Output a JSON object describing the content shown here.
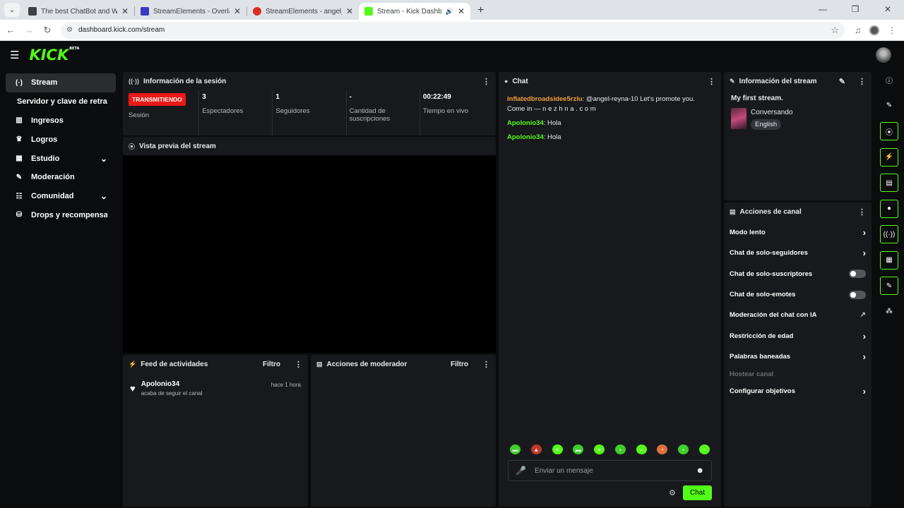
{
  "browser": {
    "tabs": [
      {
        "title": "The best ChatBot and Widgets",
        "fav_color": "#3c4043",
        "active": false
      },
      {
        "title": "StreamElements - Overlays",
        "fav_color": "#3a3bbf",
        "active": false
      },
      {
        "title": "StreamElements - angel_reyna_",
        "fav_color": "#d93025",
        "active": false
      },
      {
        "title": "Stream - Kick Dashboard",
        "fav_color": "#53fc18",
        "active": true
      }
    ],
    "url": "dashboard.kick.com/stream"
  },
  "app": {
    "logo": "KICK",
    "logo_badge": "BETA"
  },
  "sidebar": {
    "items": [
      {
        "label": "Stream",
        "icon": "(·)"
      },
      {
        "label": "Servidor y clave de retransmisión",
        "icon": ""
      },
      {
        "label": "Ingresos",
        "icon": "▥"
      },
      {
        "label": "Logros",
        "icon": "🏆"
      },
      {
        "label": "Estudio",
        "icon": "▦"
      },
      {
        "label": "Moderación",
        "icon": "🔧"
      },
      {
        "label": "Comunidad",
        "icon": "☷"
      },
      {
        "label": "Drops y recompensas",
        "icon": "⛁"
      }
    ]
  },
  "session": {
    "title": "Información de la sesión",
    "live_badge": "TRANSMITIENDO",
    "stats": [
      {
        "value": "",
        "label": "Sesión"
      },
      {
        "value": "3",
        "label": "Espectadores"
      },
      {
        "value": "1",
        "label": "Seguidores"
      },
      {
        "value": "-",
        "label": "Cantidad de suscripciones"
      },
      {
        "value": "00:22:49",
        "label": "Tiempo en vivo"
      }
    ]
  },
  "preview": {
    "title": "Vista previa del stream"
  },
  "feed": {
    "title": "Feed de actividades",
    "filter": "Filtro",
    "item": {
      "name": "Apolonio34",
      "desc": "acaba de seguir el canal",
      "time": "hace 1 hora"
    }
  },
  "modactions": {
    "title": "Acciones de moderador",
    "filter": "Filtro"
  },
  "chat": {
    "title": "Chat",
    "messages": [
      {
        "user": "inflatedbroadsidee5rzlu",
        "text": ": @angel-reyna-10 Let's promote you. Come in — n e z h n a . c o m"
      },
      {
        "user": "Apolonio34",
        "text": ": Hola"
      },
      {
        "user": "Apolonio34",
        "text": ": Hola"
      }
    ],
    "placeholder": "Enviar un mensaje",
    "send": "Chat"
  },
  "stream_info": {
    "title": "Información del stream",
    "stream_title": "My first stream.",
    "category": "Conversando",
    "language": "English"
  },
  "channel_actions": {
    "title": "Acciones de canal",
    "items": {
      "slow": "Modo lento",
      "followers": "Chat de solo-seguidores",
      "subs": "Chat de solo-suscriptores",
      "emotes": "Chat de solo-emotes",
      "ai": "Moderación del chat con IA",
      "age": "Restricción de edad",
      "banned": "Palabras baneadas",
      "host": "Hostear canal",
      "goals": "Configurar objetivos"
    }
  }
}
